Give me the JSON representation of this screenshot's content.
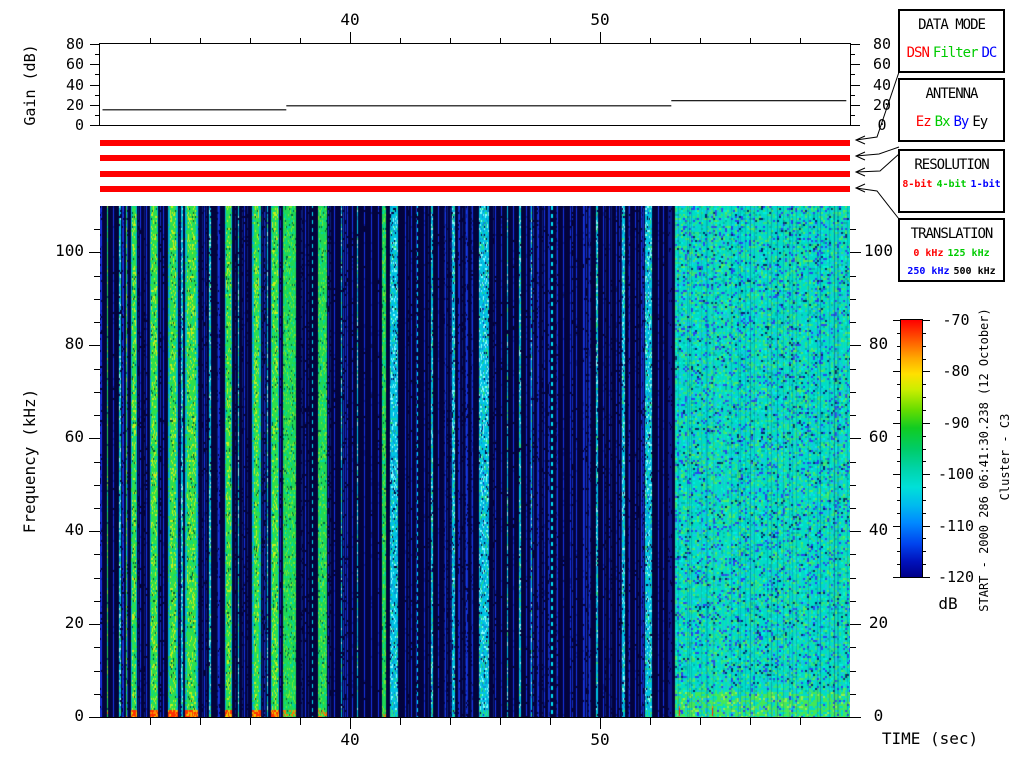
{
  "annotations": {
    "start_label": "START - 2000 286 06:41:30.238 (12 October)",
    "spacecraft": "Cluster - C3"
  },
  "chart_data": [
    {
      "type": "line",
      "ylabel": "Gain (dB)",
      "xlim": [
        30,
        60
      ],
      "ylim": [
        0,
        80
      ],
      "yticks": [
        0,
        20,
        40,
        60,
        80
      ],
      "yticks_minor": [
        10,
        30,
        50,
        70
      ],
      "xticks": [
        40,
        50
      ],
      "xtick_labels": [
        "40",
        "50"
      ],
      "ytick_labels": [
        "0",
        "20",
        "40",
        "60",
        "80"
      ],
      "xticks_minor": [
        32,
        34,
        36,
        38,
        42,
        44,
        46,
        48,
        52,
        54,
        56,
        58
      ],
      "grid": false,
      "series": [
        {
          "name": "receiver-gain",
          "steps": [
            [
              30.1,
              37.45,
              15
            ],
            [
              37.45,
              52.85,
              19
            ],
            [
              52.85,
              59.85,
              24
            ]
          ]
        }
      ]
    },
    {
      "type": "heatmap",
      "xlabel": "TIME (sec)",
      "ylabel": "Frequency (kHz)",
      "zlabel": "dB",
      "xlim": [
        30,
        60
      ],
      "ylim": [
        0,
        110
      ],
      "zlim": [
        -70,
        -120
      ],
      "xticks": [
        40,
        50
      ],
      "xtick_labels": [
        "40",
        "50"
      ],
      "yticks": [
        0,
        20,
        40,
        60,
        80,
        100
      ],
      "ytick_labels": [
        "0",
        "20",
        "40",
        "60",
        "80",
        "100"
      ],
      "background_color": "#03033c",
      "noise_region": {
        "t_start": 53.0,
        "t_end": 60.0,
        "reds_at": [
          53.14,
          54.48
        ]
      },
      "stripes": [
        [
          30.06,
          1,
          "b"
        ],
        [
          30.28,
          1,
          "g1"
        ],
        [
          30.52,
          1,
          "b"
        ],
        [
          30.76,
          2,
          "c"
        ],
        [
          30.92,
          1,
          "b"
        ],
        [
          31.04,
          1,
          "g1"
        ],
        [
          31.24,
          6,
          "g2"
        ],
        [
          31.6,
          1,
          "b"
        ],
        [
          31.84,
          1,
          "b"
        ],
        [
          32.0,
          8,
          "g2"
        ],
        [
          32.52,
          1,
          "b"
        ],
        [
          32.72,
          10,
          "g2"
        ],
        [
          33.24,
          2,
          "c"
        ],
        [
          33.4,
          13,
          "g2"
        ],
        [
          34.16,
          1,
          "b"
        ],
        [
          34.36,
          2,
          "c"
        ],
        [
          34.72,
          1,
          "b"
        ],
        [
          35.0,
          7,
          "g2"
        ],
        [
          35.52,
          1,
          "c"
        ],
        [
          35.76,
          1,
          "b"
        ],
        [
          36.08,
          9,
          "g2"
        ],
        [
          36.68,
          1,
          "c"
        ],
        [
          36.84,
          8,
          "g2"
        ],
        [
          37.32,
          13,
          "g1"
        ],
        [
          38.2,
          1,
          "b"
        ],
        [
          38.48,
          1,
          "cd"
        ],
        [
          38.72,
          9,
          "g1"
        ],
        [
          39.36,
          1,
          "b"
        ],
        [
          39.64,
          1,
          "c"
        ],
        [
          39.88,
          1,
          "b"
        ],
        [
          40.08,
          1,
          "b"
        ],
        [
          40.28,
          1,
          "c"
        ],
        [
          40.56,
          1,
          "b"
        ],
        [
          40.84,
          1,
          "b"
        ],
        [
          41.12,
          1,
          "b"
        ],
        [
          41.28,
          4,
          "g1"
        ],
        [
          41.6,
          8,
          "c"
        ],
        [
          42.2,
          1,
          "b"
        ],
        [
          42.44,
          1,
          "b"
        ],
        [
          42.68,
          1,
          "cd"
        ],
        [
          42.96,
          1,
          "b"
        ],
        [
          43.24,
          2,
          "c"
        ],
        [
          43.52,
          1,
          "b"
        ],
        [
          43.8,
          1,
          "b"
        ],
        [
          44.08,
          3,
          "c"
        ],
        [
          44.36,
          1,
          "b"
        ],
        [
          44.64,
          1,
          "b"
        ],
        [
          44.88,
          1,
          "b"
        ],
        [
          45.16,
          10,
          "c"
        ],
        [
          45.8,
          1,
          "b"
        ],
        [
          46.04,
          1,
          "b"
        ],
        [
          46.28,
          1,
          "c"
        ],
        [
          46.52,
          1,
          "b"
        ],
        [
          46.76,
          2,
          "c"
        ],
        [
          47.04,
          1,
          "b"
        ],
        [
          47.24,
          1,
          "c"
        ],
        [
          47.52,
          1,
          "b"
        ],
        [
          47.76,
          1,
          "b"
        ],
        [
          48.04,
          2,
          "cd"
        ],
        [
          48.28,
          1,
          "b"
        ],
        [
          48.52,
          1,
          "b"
        ],
        [
          48.8,
          1,
          "b"
        ],
        [
          49.04,
          1,
          "b"
        ],
        [
          49.32,
          1,
          "b"
        ],
        [
          49.56,
          1,
          "b"
        ],
        [
          49.84,
          2,
          "c"
        ],
        [
          50.12,
          1,
          "b"
        ],
        [
          50.36,
          1,
          "b"
        ],
        [
          50.64,
          1,
          "b"
        ],
        [
          50.88,
          3,
          "c"
        ],
        [
          51.16,
          1,
          "b"
        ],
        [
          51.4,
          1,
          "b"
        ],
        [
          51.64,
          1,
          "b"
        ],
        [
          51.8,
          7,
          "c"
        ],
        [
          52.32,
          1,
          "b"
        ],
        [
          52.52,
          1,
          "b"
        ],
        [
          52.72,
          4,
          "db"
        ]
      ]
    }
  ],
  "status_bars": {
    "color": "#ff0000",
    "bars": [
      {
        "name": "data-mode-bar",
        "value": "DSN"
      },
      {
        "name": "antenna-bar",
        "value": "Ez"
      },
      {
        "name": "resolution-bar",
        "value": "8-bit"
      },
      {
        "name": "translation-bar",
        "value": "0 kHz"
      }
    ]
  },
  "legend_boxes": [
    {
      "title": "DATA MODE",
      "lines": [
        [
          {
            "t": "DSN",
            "c": "#ff0000"
          },
          {
            "t": "Filter",
            "c": "#00cc00"
          },
          {
            "t": "DC",
            "c": "#0000ff"
          }
        ]
      ],
      "small": false
    },
    {
      "title": "ANTENNA",
      "lines": [
        [
          {
            "t": "Ez",
            "c": "#ff0000"
          },
          {
            "t": "Bx",
            "c": "#00cc00"
          },
          {
            "t": "By",
            "c": "#0000ff"
          },
          {
            "t": "Ey",
            "c": "#000000"
          }
        ]
      ],
      "small": false
    },
    {
      "title": "RESOLUTION",
      "lines": [
        [
          {
            "t": "8-bit",
            "c": "#ff0000"
          },
          {
            "t": "4-bit",
            "c": "#00cc00"
          },
          {
            "t": "1-bit",
            "c": "#0000ff"
          }
        ]
      ],
      "small": true
    },
    {
      "title": "TRANSLATION",
      "lines": [
        [
          {
            "t": "0 kHz",
            "c": "#ff0000"
          },
          {
            "t": "125 kHz",
            "c": "#00cc00"
          }
        ],
        [
          {
            "t": "250 kHz",
            "c": "#0000ff"
          },
          {
            "t": "500 kHz",
            "c": "#000000"
          }
        ]
      ],
      "small": true
    }
  ],
  "colorbar": {
    "unit": "dB",
    "ticks": [
      -70,
      -80,
      -90,
      -100,
      -110,
      -120
    ],
    "tick_labels": [
      "-70",
      "-80",
      "-90",
      "-100",
      "-110",
      "-120"
    ],
    "minor_step": 2.5,
    "stops": [
      [
        "#ff0000",
        0
      ],
      [
        "#ff6600",
        0.09
      ],
      [
        "#ffaa00",
        0.15
      ],
      [
        "#ffe000",
        0.21
      ],
      [
        "#ccee00",
        0.27
      ],
      [
        "#66dd00",
        0.35
      ],
      [
        "#11cc22",
        0.42
      ],
      [
        "#00cc66",
        0.5
      ],
      [
        "#00d4aa",
        0.58
      ],
      [
        "#00e0d8",
        0.65
      ],
      [
        "#00bbee",
        0.72
      ],
      [
        "#0088ff",
        0.79
      ],
      [
        "#0044ee",
        0.87
      ],
      [
        "#0011bb",
        0.94
      ],
      [
        "#000088",
        1
      ]
    ]
  }
}
